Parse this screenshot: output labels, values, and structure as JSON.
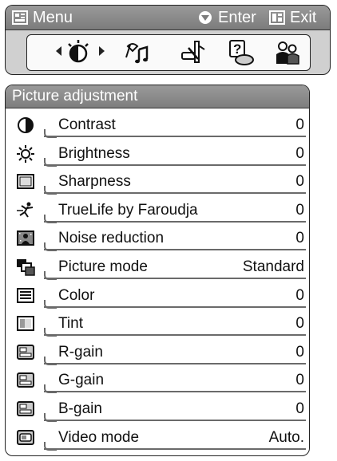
{
  "menu": {
    "title": "Menu",
    "enter_label": "Enter",
    "exit_label": "Exit",
    "icons": [
      "picture-icon",
      "sound-icon",
      "setup-icon",
      "help-icon",
      "users-icon"
    ]
  },
  "adjustment": {
    "title": "Picture adjustment",
    "items": [
      {
        "label": "Contrast",
        "value": "0",
        "icon": "contrast-icon"
      },
      {
        "label": "Brightness",
        "value": "0",
        "icon": "brightness-icon"
      },
      {
        "label": "Sharpness",
        "value": "0",
        "icon": "sharpness-icon"
      },
      {
        "label": "TrueLife by Faroudja",
        "value": "0",
        "icon": "truelife-icon"
      },
      {
        "label": "Noise reduction",
        "value": "0",
        "icon": "noise-reduction-icon"
      },
      {
        "label": "Picture mode",
        "value": "Standard",
        "icon": "picture-mode-icon"
      },
      {
        "label": "Color",
        "value": "0",
        "icon": "color-icon"
      },
      {
        "label": "Tint",
        "value": "0",
        "icon": "tint-icon"
      },
      {
        "label": "R-gain",
        "value": "0",
        "icon": "r-gain-icon"
      },
      {
        "label": "G-gain",
        "value": "0",
        "icon": "g-gain-icon"
      },
      {
        "label": "B-gain",
        "value": "0",
        "icon": "b-gain-icon"
      },
      {
        "label": "Video mode",
        "value": "Auto.",
        "icon": "video-mode-icon"
      }
    ]
  },
  "colors": {
    "header_bg": "#8a8a8a",
    "menu_panel_bg": "#d0d0d0",
    "text": "#111111",
    "underline": "#6a6a6a"
  }
}
